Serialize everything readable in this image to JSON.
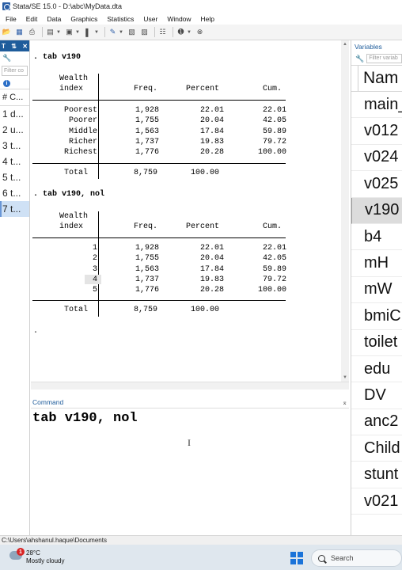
{
  "window": {
    "title": "Stata/SE 15.0 - D:\\abc\\MyData.dta"
  },
  "menu": [
    "File",
    "Edit",
    "Data",
    "Graphics",
    "Statistics",
    "User",
    "Window",
    "Help"
  ],
  "history": {
    "filter_placeholder": "Filter co",
    "column": "# C...",
    "items": [
      "1 d...",
      "2 u...",
      "3 t...",
      "4 t...",
      "5 t...",
      "6 t...",
      "7 t..."
    ]
  },
  "results": {
    "cmd1": ". tab v190",
    "cmd2": ". tab v190, nol",
    "prompt": ".",
    "head_row1": "Wealth",
    "head_row2": "index",
    "col_freq": "Freq.",
    "col_percent": "Percent",
    "col_cum": "Cum.",
    "table1": [
      {
        "label": "Poorest",
        "freq": "1,928",
        "pct": "22.01",
        "cum": "22.01"
      },
      {
        "label": "Poorer",
        "freq": "1,755",
        "pct": "20.04",
        "cum": "42.05"
      },
      {
        "label": "Middle",
        "freq": "1,563",
        "pct": "17.84",
        "cum": "59.89"
      },
      {
        "label": "Richer",
        "freq": "1,737",
        "pct": "19.83",
        "cum": "79.72"
      },
      {
        "label": "Richest",
        "freq": "1,776",
        "pct": "20.28",
        "cum": "100.00"
      }
    ],
    "table1_total": {
      "label": "Total",
      "freq": "8,759",
      "pct": "100.00"
    },
    "table2": [
      {
        "label": "1",
        "freq": "1,928",
        "pct": "22.01",
        "cum": "22.01"
      },
      {
        "label": "2",
        "freq": "1,755",
        "pct": "20.04",
        "cum": "42.05"
      },
      {
        "label": "3",
        "freq": "1,563",
        "pct": "17.84",
        "cum": "59.89"
      },
      {
        "label": "4",
        "freq": "1,737",
        "pct": "19.83",
        "cum": "79.72"
      },
      {
        "label": "5",
        "freq": "1,776",
        "pct": "20.28",
        "cum": "100.00"
      }
    ],
    "table2_total": {
      "label": "Total",
      "freq": "8,759",
      "pct": "100.00"
    }
  },
  "command": {
    "label": "Command",
    "text": "tab v190, nol"
  },
  "variables": {
    "label": "Variables",
    "filter_placeholder": "Filter variab",
    "column": "Nam",
    "items": [
      "main_",
      "v012",
      "v024",
      "v025",
      "v190",
      "b4",
      "mH",
      "mW",
      "bmiC",
      "toilet",
      "edu",
      "DV",
      "anc2",
      "Child",
      "stunt",
      "v021"
    ],
    "selected": 4
  },
  "status": {
    "path": "C:\\Users\\ahshanul.haque\\Documents"
  },
  "taskbar": {
    "badge": "1",
    "temp": "28°C",
    "condition": "Mostly cloudy",
    "search": "Search"
  }
}
